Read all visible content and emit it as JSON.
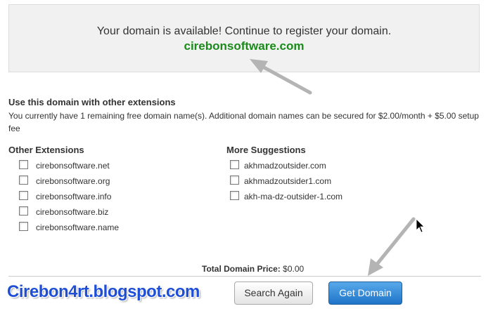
{
  "banner": {
    "message": "Your domain is available! Continue to register your domain.",
    "domain": "cirebonsoftware.com"
  },
  "extensions_section": {
    "title": "Use this domain with other extensions",
    "description": "You currently have 1 remaining free domain name(s). Additional domain names can be secured for $2.00/month + $5.00 setup fee"
  },
  "other_extensions": {
    "title": "Other Extensions",
    "items": [
      {
        "label": "cirebonsoftware.net",
        "checked": false
      },
      {
        "label": "cirebonsoftware.org",
        "checked": false
      },
      {
        "label": "cirebonsoftware.info",
        "checked": false
      },
      {
        "label": "cirebonsoftware.biz",
        "checked": false
      },
      {
        "label": "cirebonsoftware.name",
        "checked": false
      }
    ]
  },
  "more_suggestions": {
    "title": "More Suggestions",
    "items": [
      {
        "label": "akhmadzoutsider.com",
        "checked": false
      },
      {
        "label": "akhmadzoutsider1.com",
        "checked": false
      },
      {
        "label": "akh-ma-dz-outsider-1.com",
        "checked": false
      }
    ]
  },
  "total": {
    "label": "Total Domain Price:",
    "value": "$0.00"
  },
  "buttons": {
    "search_again": "Search Again",
    "get_domain": "Get Domain"
  },
  "watermark": "Cirebon4rt.blogspot.com",
  "colors": {
    "available_domain": "#1a8b1a",
    "primary_button": "#2e86d6",
    "watermark": "#1f4fd6",
    "annotation_arrow": "#b4b4b4"
  }
}
